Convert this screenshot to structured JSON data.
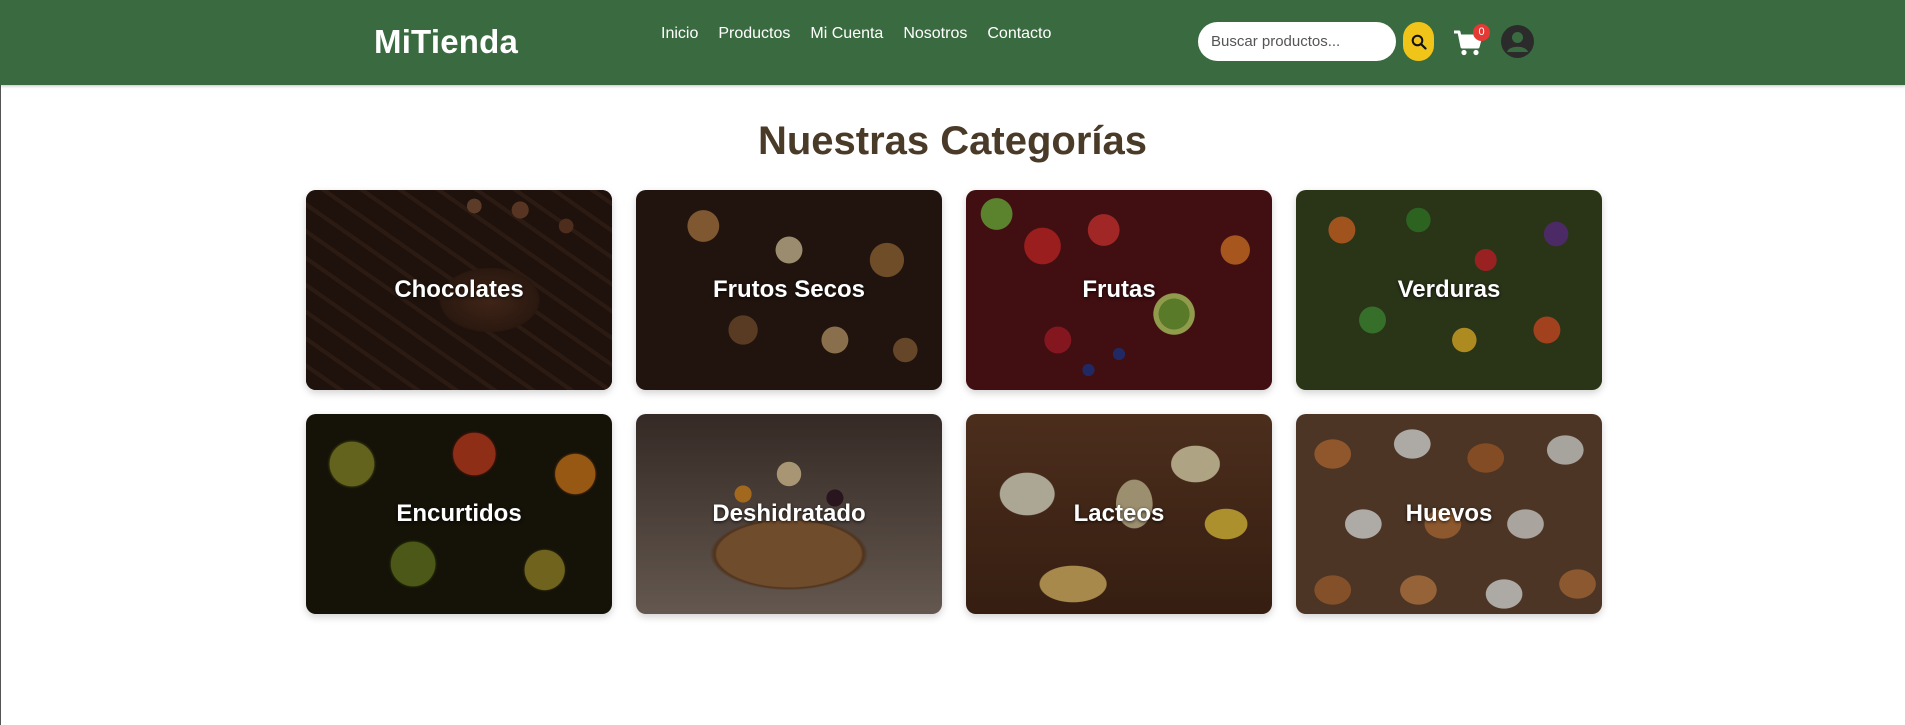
{
  "header": {
    "brand": "MiTienda",
    "nav": [
      "Inicio",
      "Productos",
      "Mi Cuenta",
      "Nosotros",
      "Contacto"
    ],
    "search": {
      "placeholder": "Buscar productos...",
      "value": ""
    },
    "search_icon": "search-icon",
    "cart_icon": "shopping-cart-icon",
    "cart_count": "0",
    "user_icon": "user-avatar-icon",
    "background_color": "#3a6b40",
    "accent_color": "#f0c419"
  },
  "main": {
    "title": "Nuestras Categorías",
    "categories": [
      {
        "label": "Chocolates"
      },
      {
        "label": "Frutos Secos"
      },
      {
        "label": "Frutas"
      },
      {
        "label": "Verduras"
      },
      {
        "label": "Encurtidos"
      },
      {
        "label": "Deshidratado"
      },
      {
        "label": "Lacteos"
      },
      {
        "label": "Huevos"
      }
    ]
  }
}
